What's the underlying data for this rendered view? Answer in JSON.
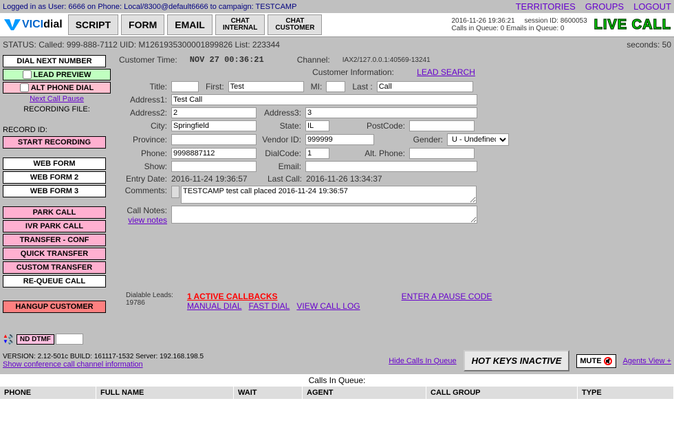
{
  "topbar": {
    "login_text": "Logged in as User: 6666 on Phone: Local/8300@default6666  to campaign: TESTCAMP",
    "links": {
      "territories": "TERRITORIES",
      "groups": "GROUPS",
      "logout": "LOGOUT"
    }
  },
  "header": {
    "tabs": {
      "script": "SCRIPT",
      "form": "FORM",
      "email": "EMAIL",
      "chat_internal": "CHAT\nINTERNAL",
      "chat_customer": "CHAT\nCUSTOMER"
    },
    "session": {
      "line1": "2016-11-26 19:36:21     session ID: 8600053",
      "line2": "Calls in Queue: 0   Emails in Queue: 0"
    },
    "livecall": "LIVE CALL"
  },
  "status": {
    "main": "STATUS: Called: 999-888-7112 UID: M1261935300001899826 List: 223344",
    "seconds": "seconds:  50"
  },
  "content": {
    "cust_time_label": "Customer Time:",
    "cust_time_value": "NOV 27 00:36:21",
    "channel_label": "Channel:",
    "channel_value": "IAX2/127.0.0.1:40569-13241",
    "cust_info_label": "Customer Information:",
    "lead_search": "LEAD SEARCH",
    "labels": {
      "title": "Title:",
      "first": "First:",
      "mi": "MI:",
      "last": "Last :",
      "addr1": "Address1:",
      "addr2": "Address2:",
      "addr3": "Address3:",
      "city": "City:",
      "state": "State:",
      "post": "PostCode:",
      "province": "Province:",
      "vendor": "Vendor ID:",
      "gender": "Gender:",
      "phone": "Phone:",
      "dialcode": "DialCode:",
      "altphone": "Alt. Phone:",
      "show": "Show:",
      "email": "Email:",
      "entry": "Entry Date:",
      "lastcall": "Last Call:",
      "comments": "Comments:",
      "callnotes": "Call Notes:"
    },
    "values": {
      "title": "",
      "first": "Test",
      "mi": "",
      "last": "Call",
      "addr1": "Test Call",
      "addr2": "2",
      "addr3": "3",
      "city": "Springfield",
      "state": "IL",
      "post": "",
      "province": "",
      "vendor": "999999",
      "gender": "U - Undefined",
      "phone": "9998887112",
      "dialcode": "1",
      "altphone": "",
      "show": "",
      "email": "",
      "entry": "2016-11-24 19:36:57",
      "lastcall": "2016-11-26 13:34:37",
      "comments": "TESTCAMP test call placed 2016-11-24 19:36:57",
      "callnotes": ""
    },
    "view_notes": "view notes"
  },
  "sidebar": {
    "dial_next": "DIAL NEXT NUMBER",
    "lead_preview": "LEAD PREVIEW",
    "alt_phone": "ALT PHONE DIAL",
    "next_pause": "Next Call Pause",
    "rec_file": "RECORDING FILE:",
    "record_id": "RECORD ID:",
    "start_rec": "START RECORDING",
    "web1": "WEB FORM",
    "web2": "WEB FORM 2",
    "web3": "WEB FORM 3",
    "park": "PARK CALL",
    "ivr_park": "IVR PARK CALL",
    "transfer": "TRANSFER - CONF",
    "quick": "QUICK  TRANSFER",
    "custom": "CUSTOM TRANSFER",
    "requeue": "RE-QUEUE CALL",
    "hangup": "HANGUP CUSTOMER",
    "dtmf": "ND DTMF"
  },
  "bottom": {
    "dialable_label": "Dialable Leads:",
    "dialable_value": "19786",
    "active_cb": "1 ACTIVE CALLBACKS",
    "manual_dial": "MANUAL DIAL",
    "fast_dial": "FAST DIAL",
    "view_log": "VIEW CALL LOG",
    "pause_code": "ENTER A PAUSE CODE"
  },
  "footer": {
    "version": "VERSION: 2.12-501c   BUILD: 161117-1532      Server: 192.168.198.5",
    "conf_link": "Show conference call channel information",
    "hide_queue": "Hide Calls In Queue",
    "hotkeys": "HOT KEYS INACTIVE",
    "mute": "MUTE",
    "agents_view": "Agents View +"
  },
  "queue": {
    "title": "Calls In Queue:",
    "cols": {
      "phone": "PHONE",
      "name": "FULL NAME",
      "wait": "WAIT",
      "agent": "AGENT",
      "group": "CALL GROUP",
      "type": "TYPE"
    }
  }
}
